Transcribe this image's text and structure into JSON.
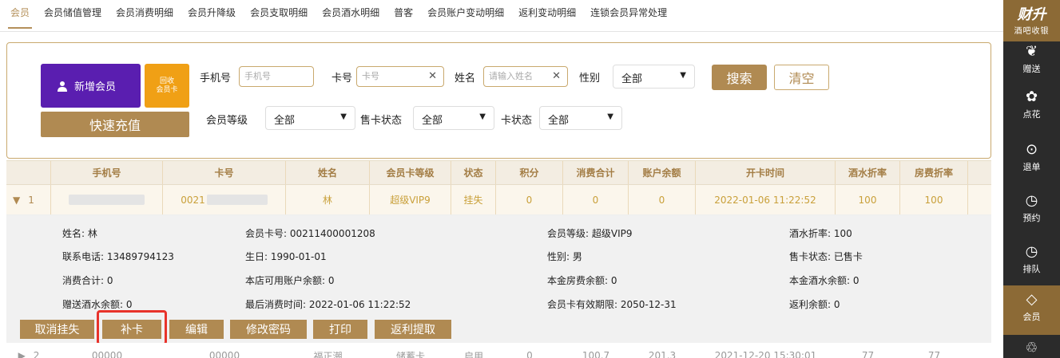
{
  "tabs": [
    "会员",
    "会员储值管理",
    "会员消费明细",
    "会员升降级",
    "会员支取明细",
    "会员酒水明细",
    "普客",
    "会员账户变动明细",
    "返利变动明细",
    "连锁会员异常处理"
  ],
  "search": {
    "new_member": "新增会员",
    "recycle_card": "回收\n会员卡",
    "quick_charge": "快速充值",
    "phone_label": "手机号",
    "phone_placeholder": "手机号",
    "card_label": "卡号",
    "card_placeholder": "卡号",
    "name_label": "姓名",
    "name_placeholder": "请输入姓名",
    "gender_label": "性别",
    "gender_value": "全部",
    "search_btn": "搜索",
    "clear_btn": "清空",
    "level_label": "会员等级",
    "level_value": "全部",
    "sale_status_label": "售卡状态",
    "sale_status_value": "全部",
    "card_status_label": "卡状态",
    "card_status_value": "全部"
  },
  "table": {
    "headers": [
      "手机号",
      "卡号",
      "姓名",
      "会员卡等级",
      "状态",
      "积分",
      "消费合计",
      "账户余额",
      "开卡时间",
      "酒水折率",
      "房费折率"
    ],
    "row1": {
      "index": "1",
      "phone": "",
      "card": "0021",
      "name": "林",
      "level": "超级VIP9",
      "status": "挂失",
      "points": "0",
      "consume": "0",
      "balance": "0",
      "open_time": "2022-01-06 11:22:52",
      "wine_rate": "100",
      "room_rate": "100"
    }
  },
  "detail": {
    "name": "姓名: 林",
    "card_no": "会员卡号: 00211400001208",
    "level": "会员等级: 超级VIP9",
    "wine_rate": "酒水折率: 100",
    "phone": "联系电话: 13489794123",
    "birthday": "生日: 1990-01-01",
    "gender": "性别: 男",
    "sale_status": "售卡状态: 已售卡",
    "consume_total": "消费合计: 0",
    "store_balance": "本店可用账户余额: 0",
    "room_principal": "本金房费余额: 0",
    "wine_principal": "本金酒水余额: 0",
    "gift_wine": "赠送酒水余额: 0",
    "last_consume": "最后消费时间: 2022-01-06 11:22:52",
    "valid_until": "会员卡有效期限: 2050-12-31",
    "rebate": "返利余额: 0"
  },
  "actions": [
    "取消挂失",
    "补卡",
    "编辑",
    "修改密码",
    "打印",
    "返利提取"
  ],
  "row2_partial": [
    "2",
    "00000",
    "00000",
    "福正潮",
    "储蓄卡",
    "启用",
    "0",
    "100.7",
    "201.3",
    "2021-12-20 15:30:01",
    "77",
    "77"
  ],
  "sidebar": {
    "brand_title": "财升",
    "brand_sub": "酒吧收银",
    "items": [
      {
        "label": "赠送",
        "icon": "gift-icon"
      },
      {
        "label": "点花",
        "icon": "flower-icon"
      },
      {
        "label": "退单",
        "icon": "refund-icon"
      },
      {
        "label": "预约",
        "icon": "clock-icon"
      },
      {
        "label": "排队",
        "icon": "queue-icon"
      },
      {
        "label": "会员",
        "icon": "diamond-icon"
      }
    ]
  },
  "colors": {
    "gold": "#b08a52",
    "purple": "#5a1eb0",
    "orange": "#f0a015",
    "highlight": "#e8332b",
    "sidebar": "#2b2b2b"
  }
}
